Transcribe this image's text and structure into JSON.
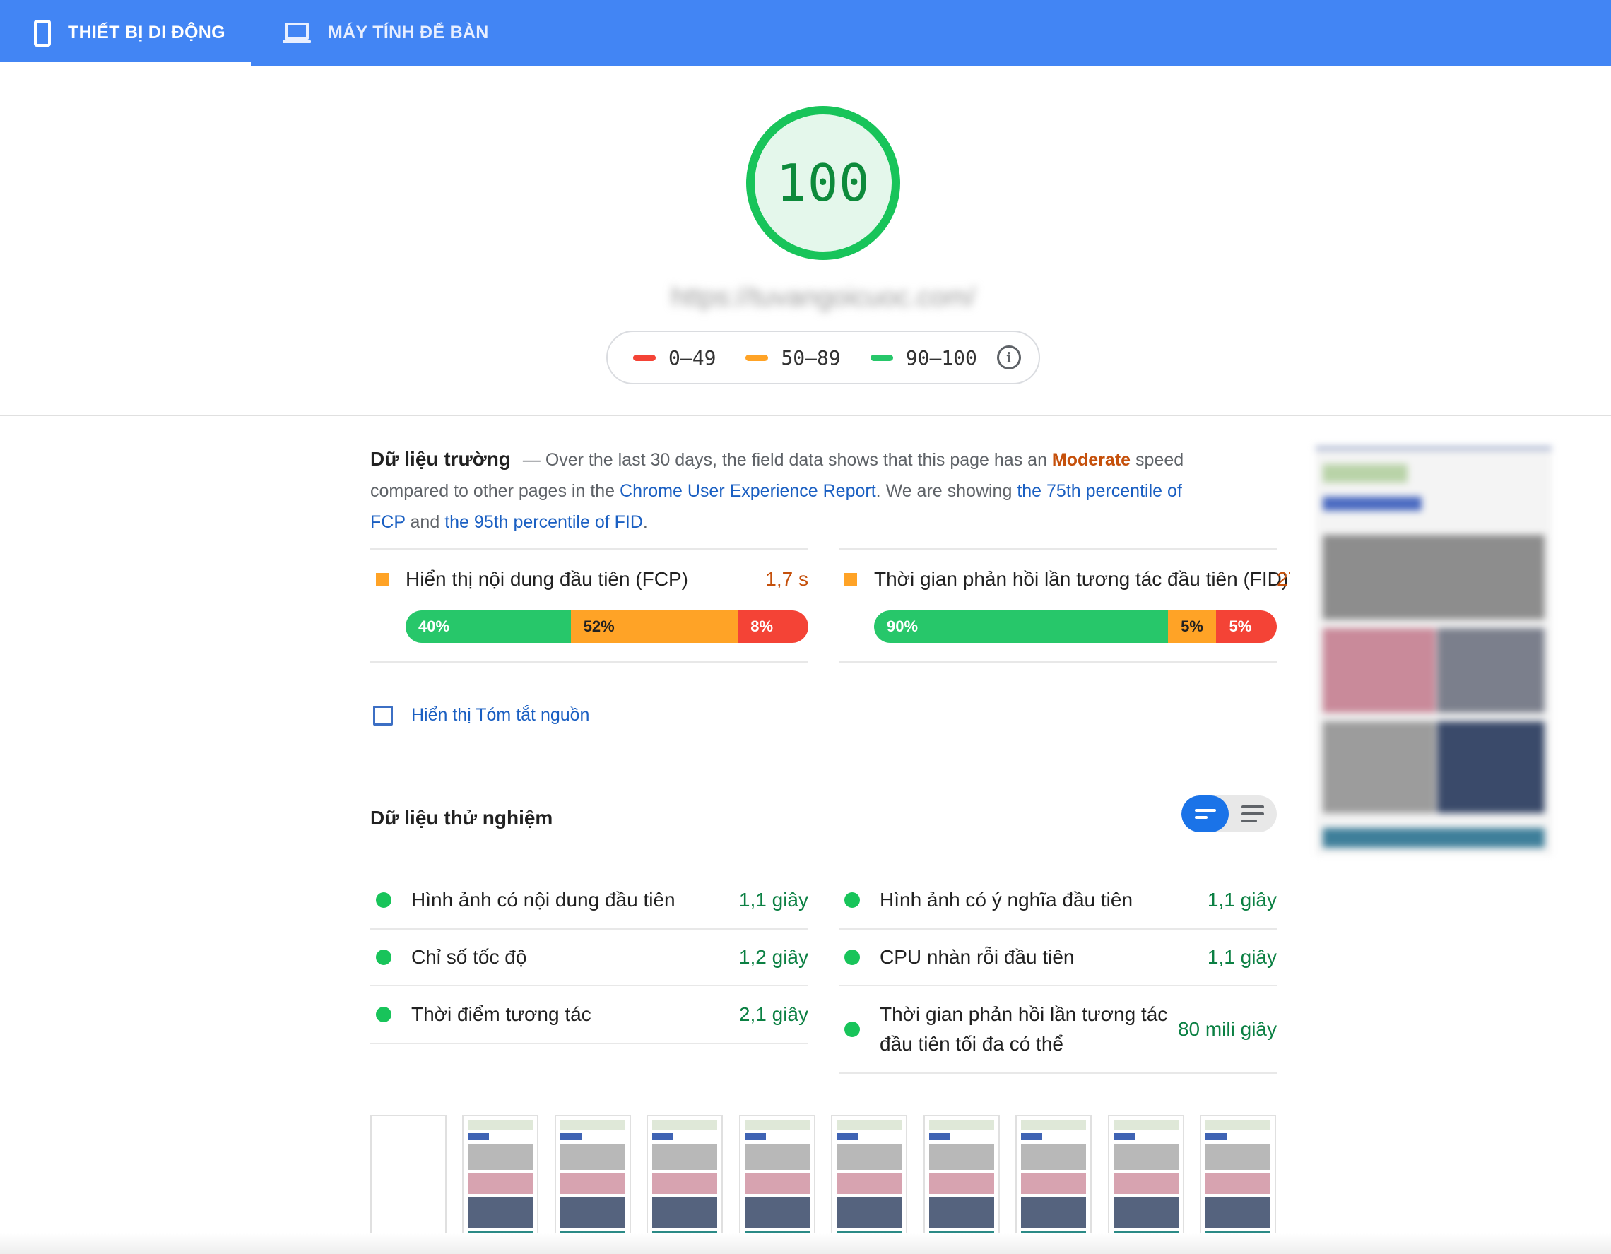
{
  "tabs": {
    "mobile": "THIẾT BỊ DI ĐỘNG",
    "desktop": "MÁY TÍNH ĐỂ BÀN"
  },
  "score": {
    "value": "100",
    "url": "https://tuvangoicuoc.com/",
    "color": "#18c45a"
  },
  "legend": {
    "poor": "0–49",
    "average": "50–89",
    "good": "90–100",
    "colors": {
      "poor": "#f44336",
      "average": "#ffa326",
      "good": "#27c76a"
    }
  },
  "field": {
    "title": "Dữ liệu trường",
    "dash": "—",
    "intro_1": "Over the last 30 days, the field data shows that this page has an",
    "speed": "Moderate",
    "intro_2": "speed compared to other pages in the",
    "report_link": "Chrome User Experience Report",
    "intro_3": ". We are showing",
    "fcp_link": "the 75th percentile of FCP",
    "and": "and",
    "fid_link": "the 95th percentile of FID",
    "period": ".",
    "fcp": {
      "label": "Hiển thị nội dung đầu tiên (FCP)",
      "value": "1,7 s",
      "fast": "40%",
      "average": "52%",
      "slow": "8%"
    },
    "fid": {
      "label": "Thời gian phản hồi lần tương tác đầu tiên (FID)",
      "value": "27",
      "fast": "90%",
      "average": "5%",
      "slow": "5%"
    },
    "origin_summary": "Hiển thị Tóm tắt nguồn"
  },
  "lab": {
    "title": "Dữ liệu thử nghiệm",
    "metrics": [
      {
        "label": "Hình ảnh có nội dung đầu tiên",
        "value": "1,1 giây"
      },
      {
        "label": "Hình ảnh có ý nghĩa đầu tiên",
        "value": "1,1 giây"
      },
      {
        "label": "Chỉ số tốc độ",
        "value": "1,2 giây"
      },
      {
        "label": "CPU nhàn rỗi đầu tiên",
        "value": "1,1 giây"
      },
      {
        "label": "Thời điểm tương tác",
        "value": "2,1 giây"
      },
      {
        "label": "Thời gian phản hồi lần tương tác đầu tiên tối đa có thể",
        "value": "80 mili giây"
      }
    ]
  },
  "icons": {
    "mobile_tab": "smartphone-icon",
    "desktop_tab": "laptop-icon",
    "legend_info": "info-icon",
    "view_toggle_compact": "compact-view-icon",
    "view_toggle_expanded": "list-view-icon"
  }
}
